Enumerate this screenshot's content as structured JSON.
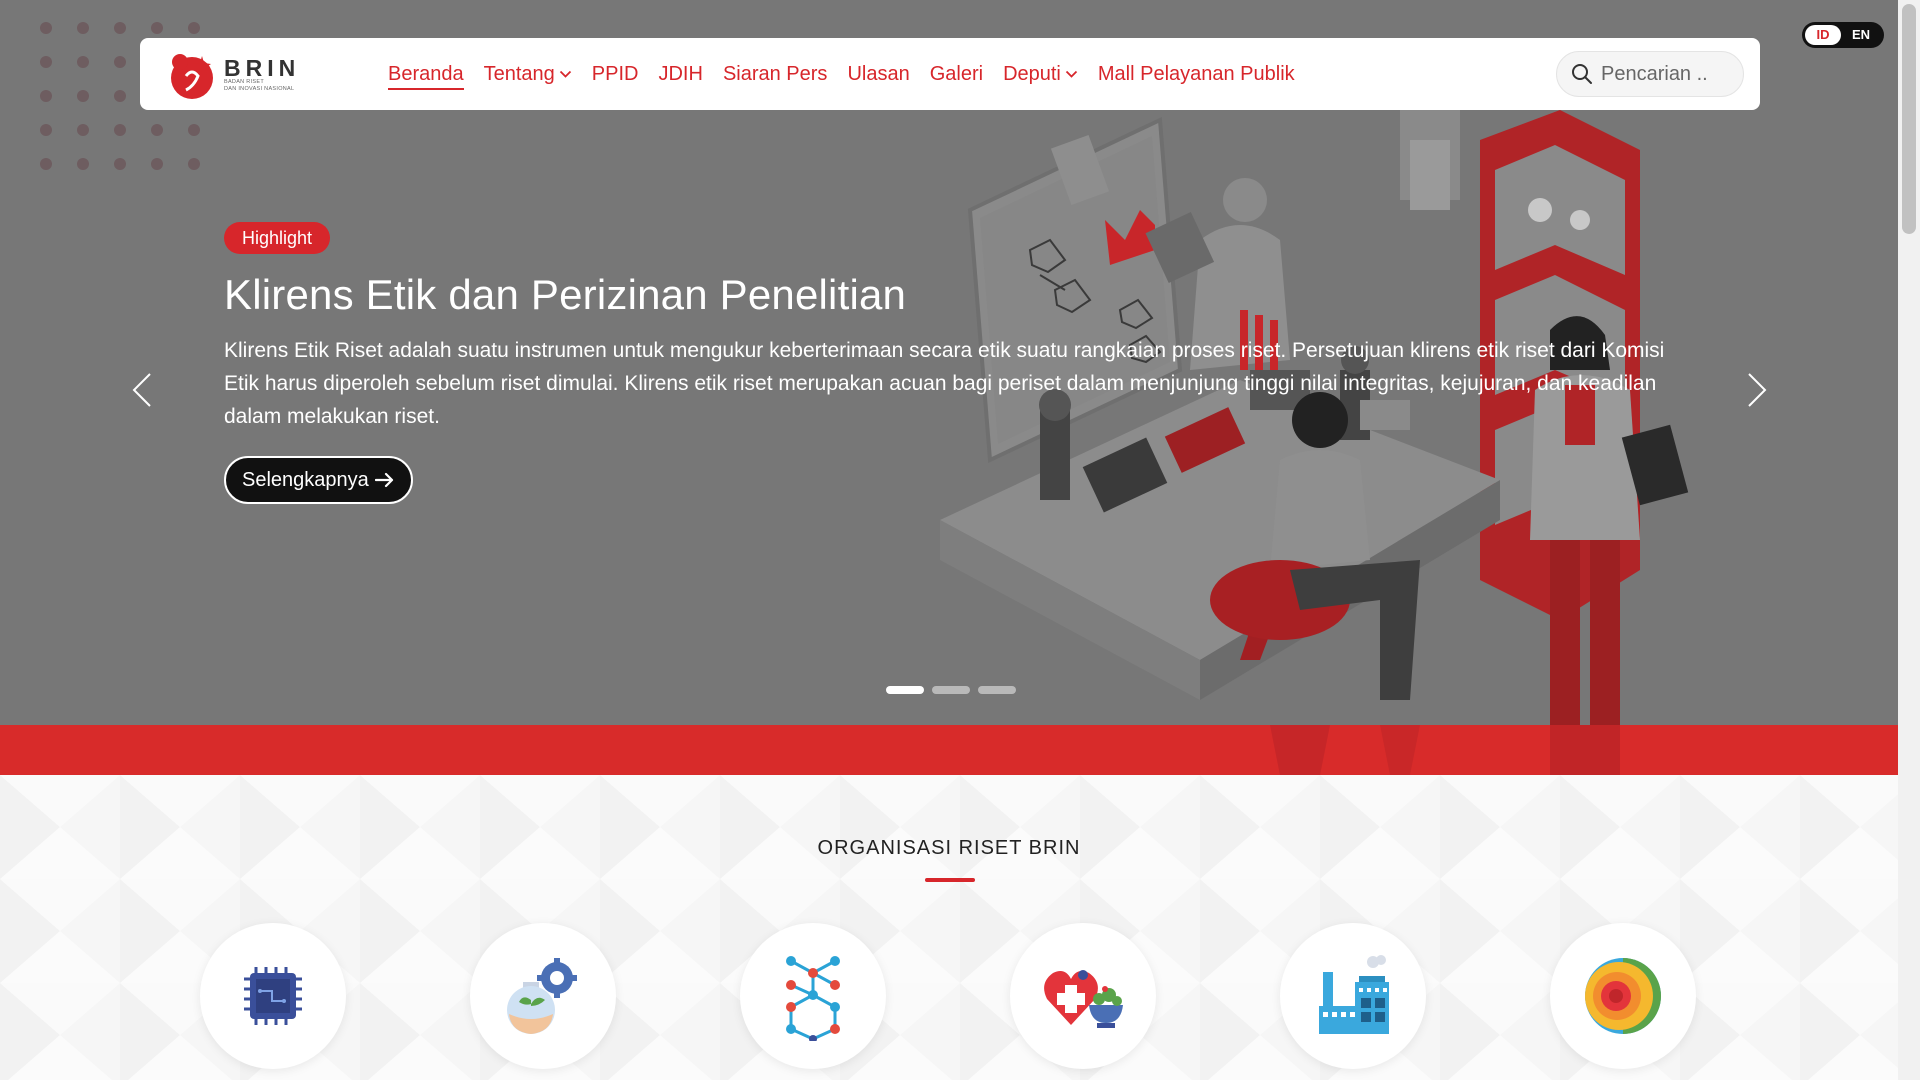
{
  "navbar": {
    "logo": {
      "title": "BRIN",
      "subtitle_line1": "BADAN RISET",
      "subtitle_line2": "DAN INOVASI NASIONAL"
    },
    "items": [
      {
        "label": "Beranda",
        "active": true,
        "dropdown": false
      },
      {
        "label": "Tentang",
        "active": false,
        "dropdown": true
      },
      {
        "label": "PPID",
        "active": false,
        "dropdown": false
      },
      {
        "label": "JDIH",
        "active": false,
        "dropdown": false
      },
      {
        "label": "Siaran Pers",
        "active": false,
        "dropdown": false
      },
      {
        "label": "Ulasan",
        "active": false,
        "dropdown": false
      },
      {
        "label": "Galeri",
        "active": false,
        "dropdown": false
      },
      {
        "label": "Deputi",
        "active": false,
        "dropdown": true
      },
      {
        "label": "Mall Pelayanan Publik",
        "active": false,
        "dropdown": false
      }
    ],
    "search": {
      "placeholder": "Pencarian .."
    }
  },
  "language": {
    "id": "ID",
    "en": "EN",
    "selected": "ID"
  },
  "hero": {
    "badge": "Highlight",
    "title": "Klirens Etik dan Perizinan Penelitian",
    "description": "Klirens Etik Riset adalah suatu instrumen untuk mengukur keberterimaan secara etik suatu rangkaian proses riset. Persetujuan klirens etik riset dari Komisi Etik harus diperoleh sebelum riset dimulai. Klirens etik riset merupakan acuan bagi periset dalam menjunjung tinggi nilai integritas, kejujuran, dan keadilan dalam melakukan riset.",
    "cta_label": "Selengkapnya",
    "slides_total": 3,
    "active_slide": 1
  },
  "section": {
    "title": "ORGANISASI RISET BRIN",
    "organizations": [
      {
        "icon": "microchip-icon"
      },
      {
        "icon": "plant-flask-gear-icon"
      },
      {
        "icon": "molecule-icon"
      },
      {
        "icon": "health-heart-icon"
      },
      {
        "icon": "factory-icon"
      },
      {
        "icon": "earth-layers-icon"
      }
    ]
  },
  "colors": {
    "brand_red": "#d7262b",
    "hero_overlay": "#777777",
    "band_red": "#d82b2a"
  }
}
